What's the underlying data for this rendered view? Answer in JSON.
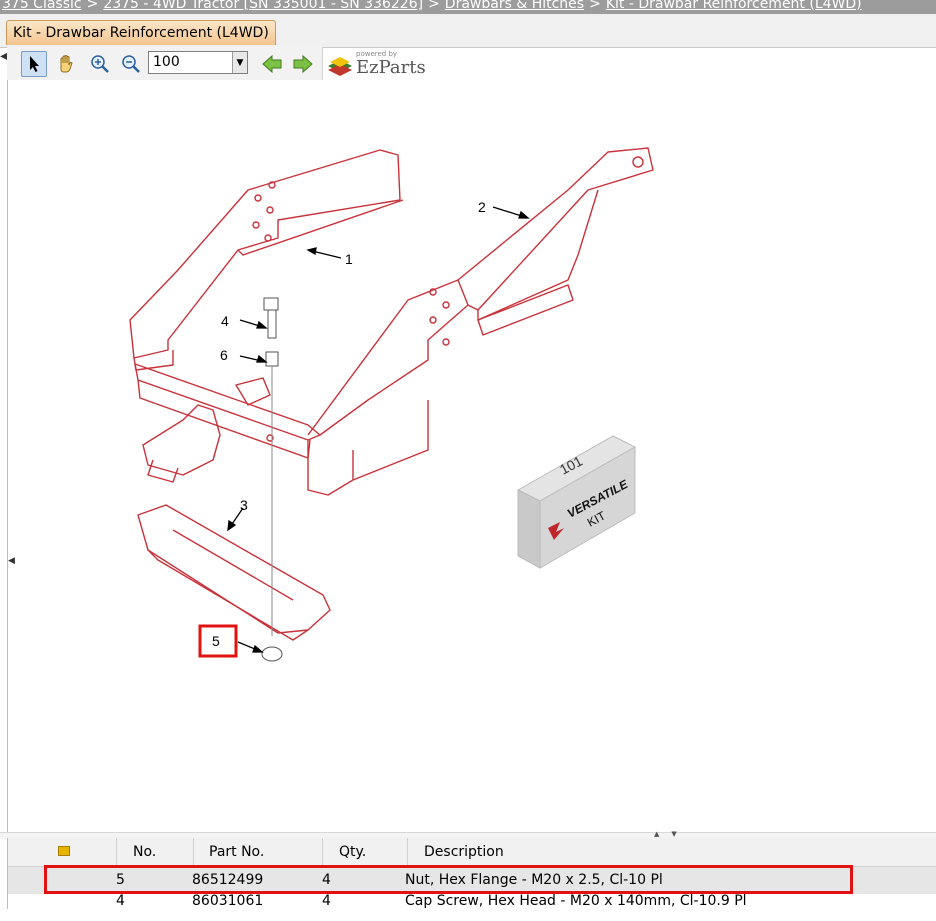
{
  "breadcrumb": {
    "items": [
      "375 Classic",
      "2375 - 4WD Tractor [SN 335001 - SN 336226]",
      "Drawbars & Hitches",
      "Kit - Drawbar Reinforcement (L4WD)"
    ],
    "separator": ">"
  },
  "tab": {
    "label": "Kit - Drawbar Reinforcement (L4WD)"
  },
  "toolbar": {
    "zoom_value": "100",
    "icons": [
      "select-arrow-icon",
      "pan-hand-icon",
      "zoom-in-icon",
      "zoom-out-icon",
      "back-arrow-icon",
      "forward-arrow-icon"
    ]
  },
  "logo": {
    "powered": "powered by",
    "name": "EzParts"
  },
  "diagram": {
    "callouts": [
      "1",
      "2",
      "3",
      "4",
      "5",
      "6"
    ],
    "selected_callout": "5",
    "kit_box": {
      "number": "101",
      "brand": "VERSATILE",
      "word": "KIT"
    }
  },
  "table": {
    "columns": [
      "No.",
      "Part No.",
      "Qty.",
      "Description"
    ],
    "rows": [
      {
        "no": "5",
        "part_no": "86512499",
        "qty": "4",
        "description": "Nut, Hex Flange - M20 x 2.5, Cl-10 Pl"
      },
      {
        "no": "4",
        "part_no": "86031061",
        "qty": "4",
        "description": "Cap Screw, Hex Head - M20 x 140mm, Cl-10.9 Pl"
      }
    ],
    "selected_row": 0
  },
  "colors": {
    "highlight": "#e01212",
    "line_art": "#c8323a",
    "tab": "#f2c58e"
  }
}
